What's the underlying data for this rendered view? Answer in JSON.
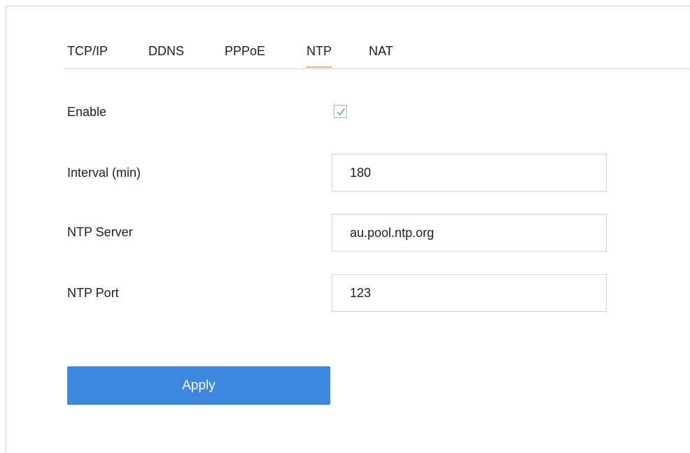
{
  "tabs": [
    {
      "label": "TCP/IP",
      "active": false
    },
    {
      "label": "DDNS",
      "active": false
    },
    {
      "label": "PPPoE",
      "active": false
    },
    {
      "label": "NTP",
      "active": true
    },
    {
      "label": "NAT",
      "active": false
    }
  ],
  "form": {
    "enable": {
      "label": "Enable",
      "checked": true
    },
    "interval": {
      "label": "Interval (min)",
      "value": "180"
    },
    "server": {
      "label": "NTP Server",
      "value": "au.pool.ntp.org"
    },
    "port": {
      "label": "NTP Port",
      "value": "123"
    }
  },
  "apply_label": "Apply",
  "colors": {
    "accent": "#3d87e0",
    "active_tab_underline": "#f0b27e",
    "checkmark": "#4a90d9"
  }
}
